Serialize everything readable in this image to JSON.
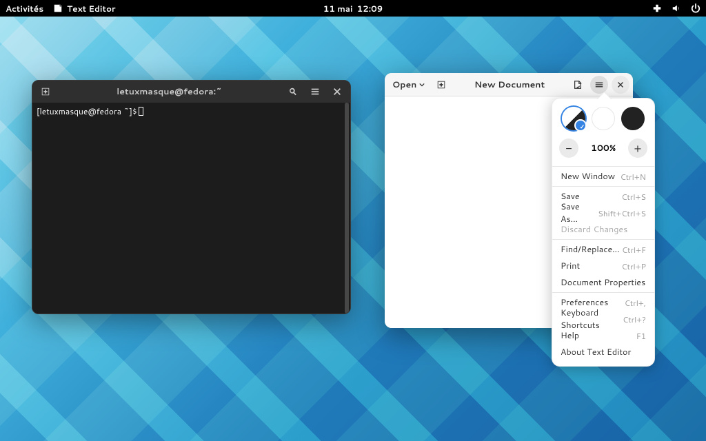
{
  "topbar": {
    "activities": "Activités",
    "app_name": "Text Editor",
    "date": "11 mai",
    "time": "12:09"
  },
  "terminal": {
    "title": "letuxmasque@fedora:~",
    "prompt": "[letuxmasque@fedora ~]$"
  },
  "editor": {
    "open_label": "Open",
    "doc_title": "New Document"
  },
  "menu": {
    "zoom_value": "100%",
    "items": [
      {
        "label": "New Window",
        "accel": "Ctrl+N"
      }
    ],
    "file": [
      {
        "label": "Save",
        "accel": "Ctrl+S"
      },
      {
        "label": "Save As…",
        "accel": "Shift+Ctrl+S"
      },
      {
        "label": "Discard Changes",
        "accel": "",
        "disabled": true
      }
    ],
    "edit": [
      {
        "label": "Find/Replace…",
        "accel": "Ctrl+F"
      },
      {
        "label": "Print",
        "accel": "Ctrl+P"
      },
      {
        "label": "Document Properties",
        "accel": ""
      }
    ],
    "misc": [
      {
        "label": "Preferences",
        "accel": "Ctrl+,"
      },
      {
        "label": "Keyboard Shortcuts",
        "accel": "Ctrl+?"
      },
      {
        "label": "Help",
        "accel": "F1"
      },
      {
        "label": "About Text Editor",
        "accel": ""
      }
    ]
  }
}
